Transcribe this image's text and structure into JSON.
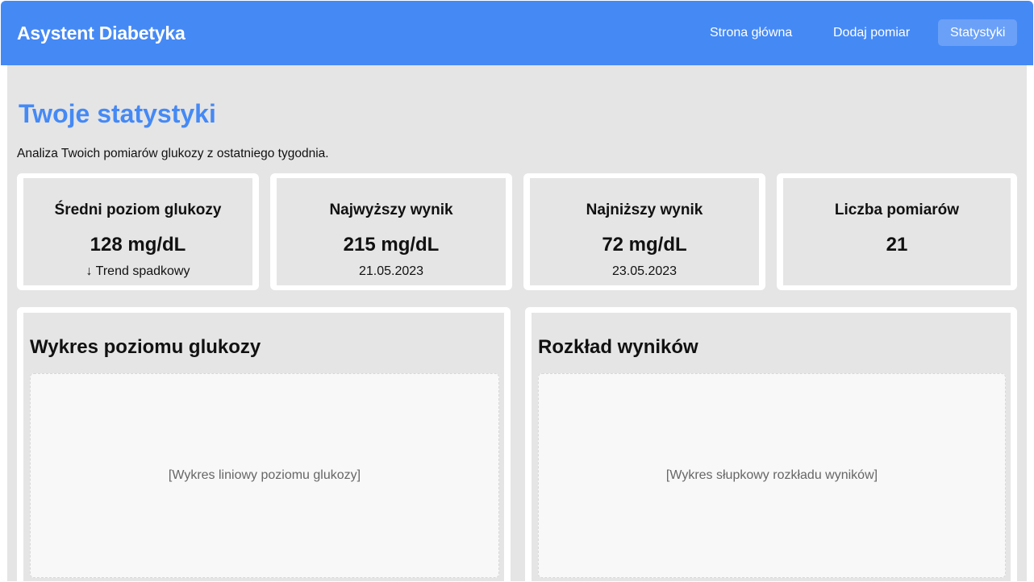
{
  "app": {
    "brand": "Asystent Diabetyka"
  },
  "nav": {
    "home": "Strona główna",
    "add": "Dodaj pomiar",
    "stats": "Statystyki",
    "active": "Statystyki"
  },
  "page": {
    "title": "Twoje statystyki",
    "subtitle": "Analiza Twoich pomiarów glukozy z ostatniego tygodnia."
  },
  "stats": [
    {
      "label": "Średni poziom glukozy",
      "value": "128 mg/dL",
      "note": "↓ Trend spadkowy"
    },
    {
      "label": "Najwyższy wynik",
      "value": "215 mg/dL",
      "note": "21.05.2023"
    },
    {
      "label": "Najniższy wynik",
      "value": "72 mg/dL",
      "note": "23.05.2023"
    },
    {
      "label": "Liczba pomiarów",
      "value": "21",
      "note": ""
    }
  ],
  "charts": {
    "line": {
      "title": "Wykres poziomu glukozy",
      "placeholder": "[Wykres liniowy poziomu glukozy]"
    },
    "distribution": {
      "title": "Rozkład wyników",
      "placeholder": "[Wykres słupkowy rozkładu wyników]"
    }
  },
  "colors": {
    "accent": "#4589f5",
    "background": "#e5e5e5",
    "card_border": "#ffffff",
    "placeholder_bg": "#f8f8f8"
  }
}
